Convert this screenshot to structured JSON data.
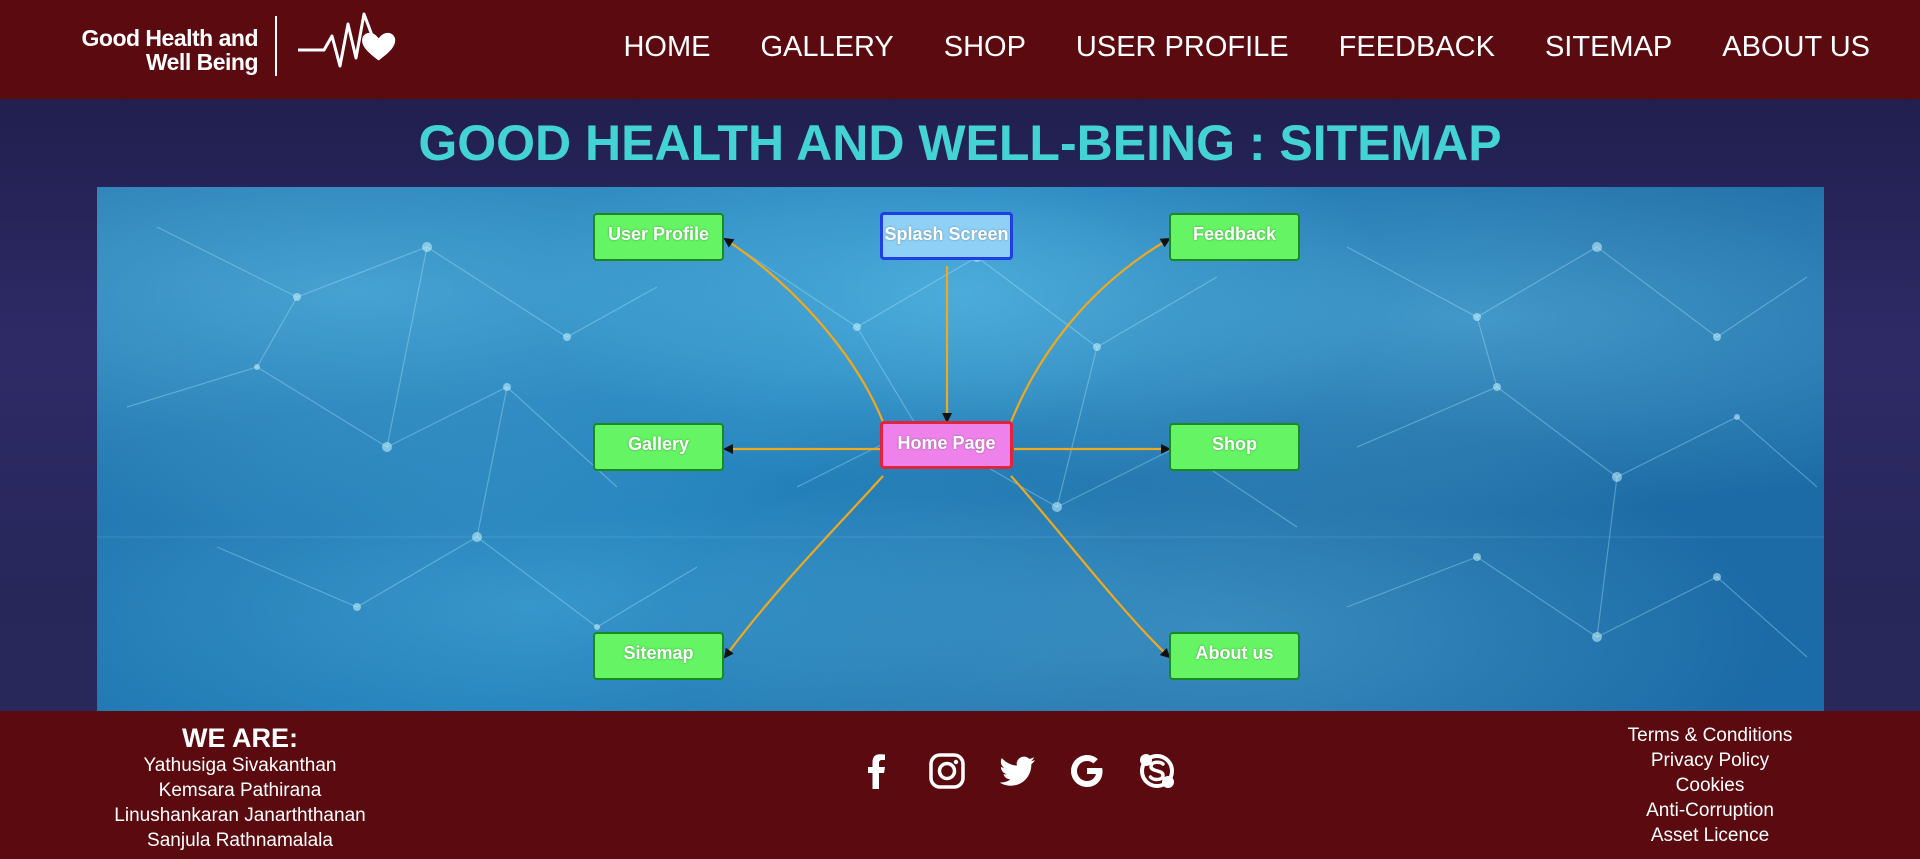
{
  "header": {
    "logo_text_line1": "Good Health and",
    "logo_text_line2": "Well Being",
    "nav": [
      "HOME",
      "GALLERY",
      "SHOP",
      "USER PROFILE",
      "FEEDBACK",
      "SITEMAP",
      "ABOUT US"
    ]
  },
  "main": {
    "title": "GOOD HEALTH AND WELL-BEING : SITEMAP",
    "sitemap": {
      "center": "Home Page",
      "top": "Splash Screen",
      "left_nodes": [
        "User Profile",
        "Gallery",
        "Sitemap"
      ],
      "right_nodes": [
        "Feedback",
        "Shop",
        "About us"
      ],
      "colors": {
        "page_node": "#65f463",
        "splash_node": "#8fd0f6",
        "home_node": "#ee82ea",
        "edge": "#f0a81c"
      }
    }
  },
  "footer": {
    "we_are_heading": "WE ARE:",
    "members": [
      "Yathusiga Sivakanthan",
      "Kemsara Pathirana",
      "Linushankaran Janarththanan",
      "Sanjula Rathnamalala"
    ],
    "socials": [
      "facebook-icon",
      "instagram-icon",
      "twitter-icon",
      "google-icon",
      "skype-icon"
    ],
    "legal_links": [
      "Terms & Conditions",
      "Privacy Policy",
      "Cookies",
      "Anti-Corruption",
      "Asset Licence"
    ]
  },
  "theme": {
    "header_bg": "#5b0b10",
    "title_color": "#44d3d5"
  }
}
